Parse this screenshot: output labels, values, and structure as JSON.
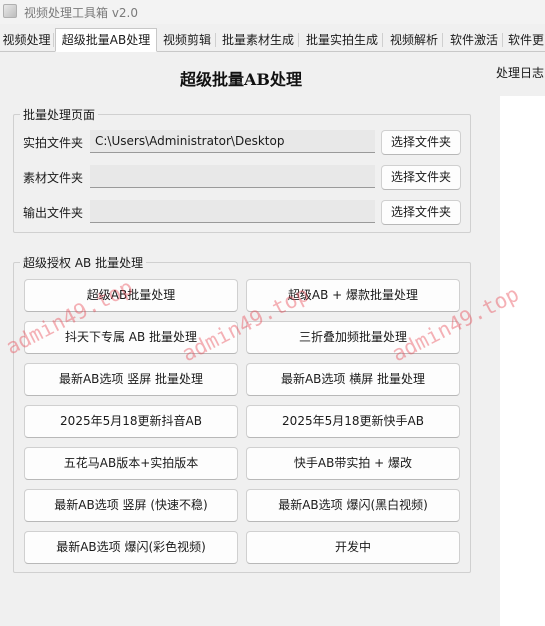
{
  "window": {
    "title": "视频处理工具箱 v2.0"
  },
  "tabs": [
    {
      "label": "视频处理"
    },
    {
      "label": "超级批量AB处理"
    },
    {
      "label": "视频剪辑"
    },
    {
      "label": "批量素材生成"
    },
    {
      "label": "批量实拍生成"
    },
    {
      "label": "视频解析"
    },
    {
      "label": "软件激活"
    },
    {
      "label": "软件更"
    }
  ],
  "main": {
    "title": "超级批量AB处理",
    "log_label": "处理日志"
  },
  "batch_group": {
    "title": "批量处理页面",
    "rows": [
      {
        "label": "实拍文件夹",
        "value": "C:\\Users\\Administrator\\Desktop",
        "button": "选择文件夹"
      },
      {
        "label": "素材文件夹",
        "value": "",
        "button": "选择文件夹"
      },
      {
        "label": "输出文件夹",
        "value": "",
        "button": "选择文件夹"
      }
    ]
  },
  "auth_group": {
    "title": "超级授权 AB 批量处理",
    "buttons": [
      "超级AB批量处理",
      "超级AB + 爆款批量处理",
      "抖天下专属 AB 批量处理",
      "三折叠加频批量处理",
      "最新AB选项 竖屏 批量处理",
      "最新AB选项 横屏 批量处理",
      "2025年5月18更新抖音AB",
      "2025年5月18更新快手AB",
      "五花马AB版本+实拍版本",
      "快手AB带实拍 + 爆改",
      "最新AB选项 竖屏 (快速不稳)",
      "最新AB选项 爆闪(黑白视频)",
      "最新AB选项 爆闪(彩色视频)",
      "开发中"
    ]
  },
  "watermark": {
    "text": "admin49.top"
  }
}
